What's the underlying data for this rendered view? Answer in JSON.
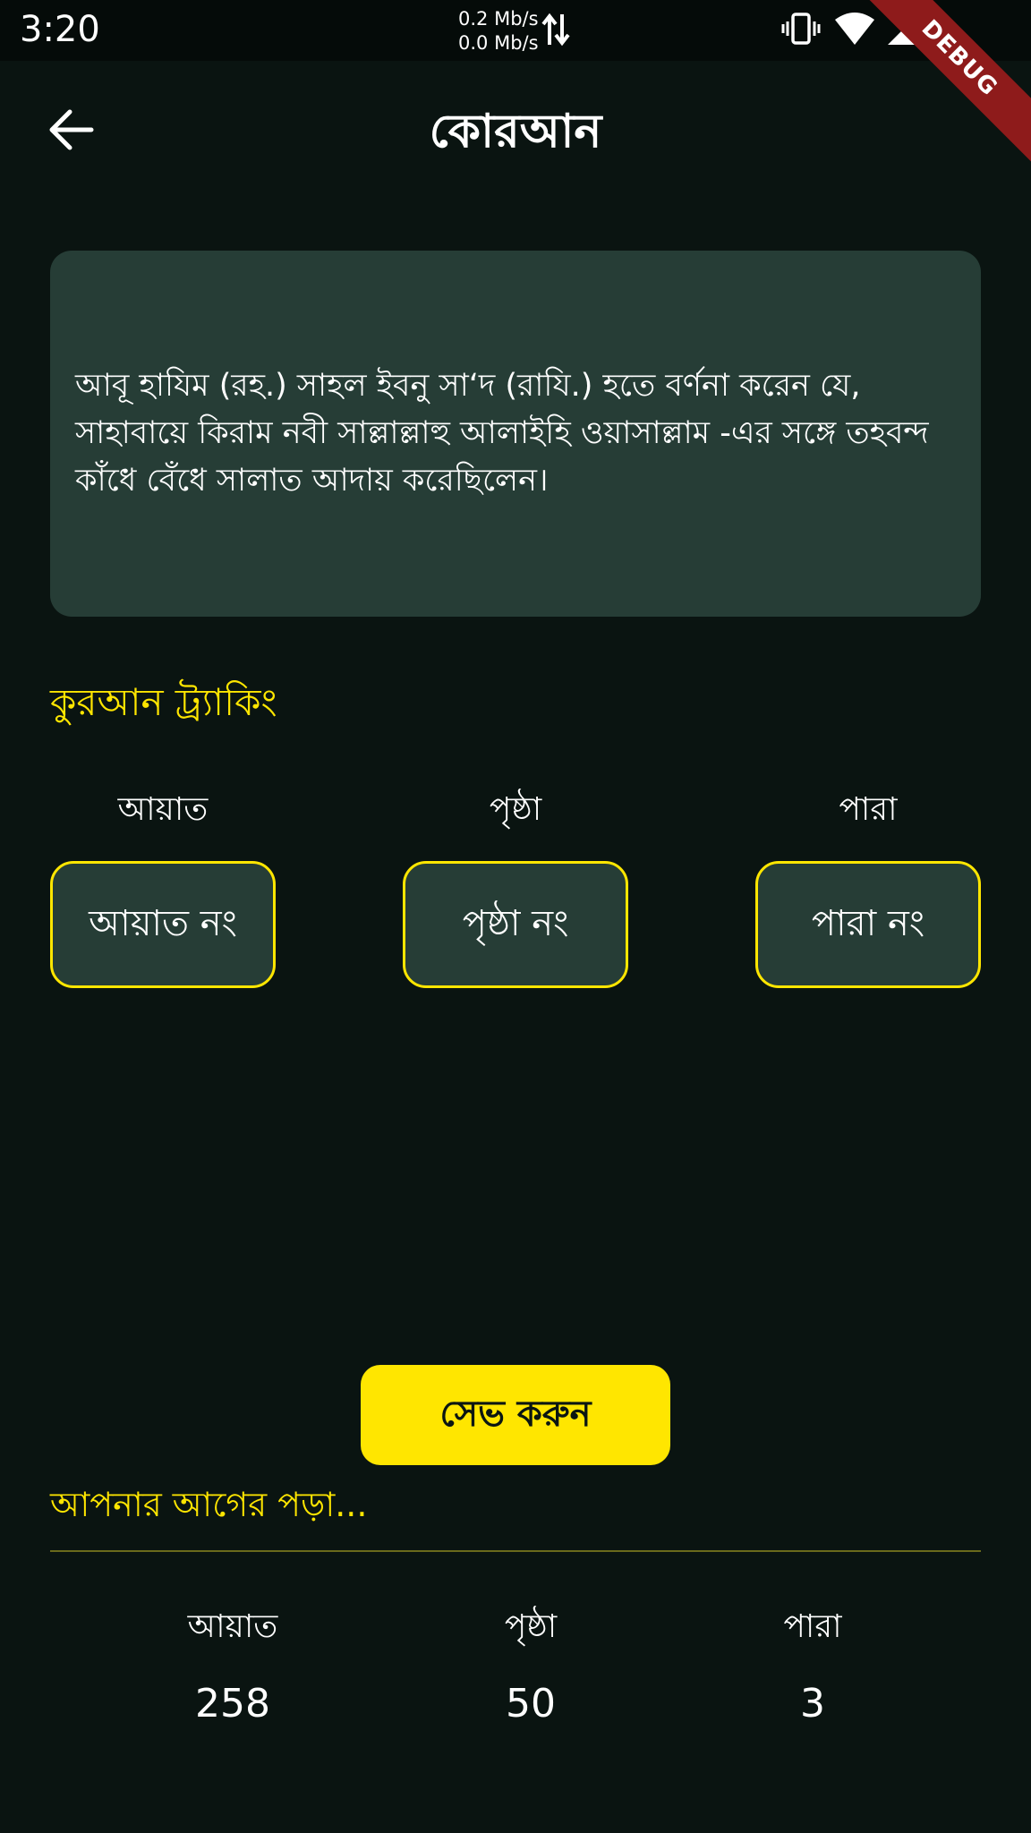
{
  "status_bar": {
    "time": "3:20",
    "upload_speed": "0.2 Mb/s",
    "download_speed": "0.0 Mb/s",
    "icons": [
      "data-transfer-icon",
      "vibrate-icon",
      "wifi-icon",
      "cell-signal-icon"
    ]
  },
  "debug_banner": "DEBUG",
  "app_bar": {
    "title": "কোরআন",
    "back_icon": "arrow-back-icon"
  },
  "hadith": {
    "text": "আবূ হাযিম (রহ.) সাহল ইবনু সা‘দ (রাযি.) হতে বর্ণনা করেন যে, সাহাবায়ে কিরাম নবী সাল্লাল্লাহু আলাইহি ওয়াসাল্লাম -এর সঙ্গে তহবন্দ কাঁধে বেঁধে সালাত আদায় করেছিলেন।"
  },
  "tracking": {
    "title": "কুরআন ট্র্যাকিং",
    "fields": [
      {
        "label": "আয়াত",
        "placeholder": "আয়াত নং"
      },
      {
        "label": "পৃষ্ঠা",
        "placeholder": "পৃষ্ঠা নং"
      },
      {
        "label": "পারা",
        "placeholder": "পারা নং"
      }
    ],
    "save_label": "সেভ করুন"
  },
  "previous": {
    "title": "আপনার আগের পড়া...",
    "columns": [
      {
        "label": "আয়াত",
        "value": "258"
      },
      {
        "label": "পৃষ্ঠা",
        "value": "50"
      },
      {
        "label": "পারা",
        "value": "3"
      }
    ]
  },
  "colors": {
    "background": "#0a1411",
    "card": "#263d36",
    "accent": "#ffe600",
    "debug_ribbon": "#8e1b1b"
  }
}
